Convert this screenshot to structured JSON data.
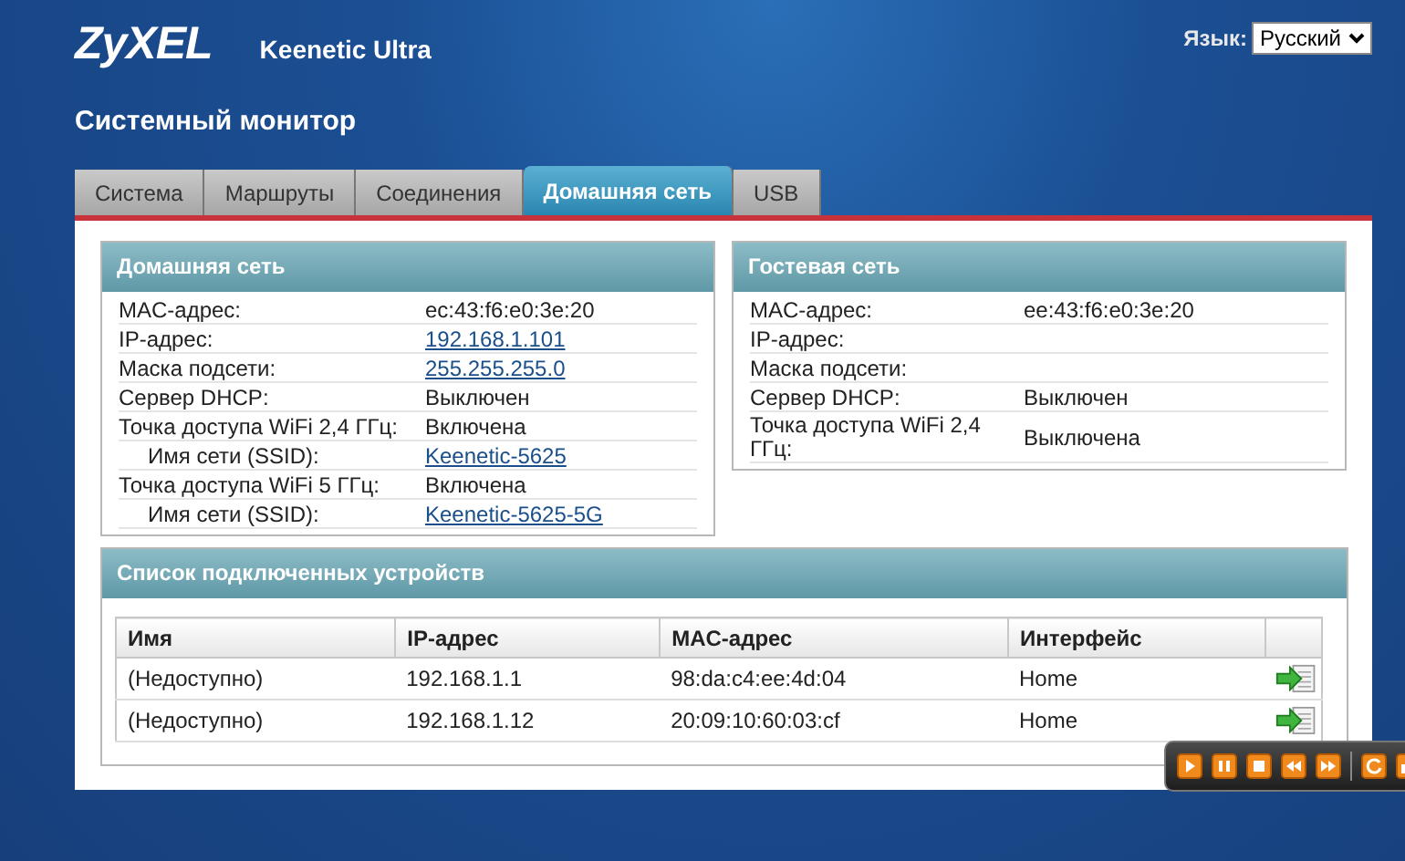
{
  "header": {
    "logo": "ZyXEL",
    "model": "Keenetic Ultra",
    "language_label": "Язык:",
    "language_value": "Русский"
  },
  "page_title": "Системный монитор",
  "tabs": [
    {
      "label": "Система",
      "selected": false
    },
    {
      "label": "Маршруты",
      "selected": false
    },
    {
      "label": "Соединения",
      "selected": false
    },
    {
      "label": "Домашняя сеть",
      "selected": true
    },
    {
      "label": "USB",
      "selected": false
    }
  ],
  "home_network": {
    "title": "Домашняя сеть",
    "rows": [
      {
        "label": "MAC-адрес:",
        "value": "ec:43:f6:e0:3e:20",
        "kind": "text"
      },
      {
        "label": "IP-адрес:",
        "value": "192.168.1.101",
        "kind": "link"
      },
      {
        "label": "Маска подсети:",
        "value": "255.255.255.0",
        "kind": "link"
      },
      {
        "label": "Сервер DHCP:",
        "value": "Выключен",
        "kind": "text"
      },
      {
        "label": "Точка доступа WiFi 2,4 ГГц:",
        "value": "Включена",
        "kind": "text",
        "children": [
          {
            "label": "Имя сети (SSID):",
            "value": "Keenetic-5625",
            "kind": "link"
          }
        ]
      },
      {
        "label": "Точка доступа WiFi 5 ГГц:",
        "value": "Включена",
        "kind": "text",
        "children": [
          {
            "label": "Имя сети (SSID):",
            "value": "Keenetic-5625-5G",
            "kind": "link"
          }
        ]
      }
    ]
  },
  "guest_network": {
    "title": "Гостевая сеть",
    "rows": [
      {
        "label": "MAC-адрес:",
        "value": "ee:43:f6:e0:3e:20",
        "kind": "text"
      },
      {
        "label": "IP-адрес:"
      },
      {
        "label": "Маска подсети:"
      },
      {
        "label": "Сервер DHCP:",
        "value": "Выключен",
        "kind": "text"
      },
      {
        "label": "Точка доступа WiFi 2,4 ГГц:",
        "value": "Выключена",
        "kind": "text"
      }
    ]
  },
  "devices": {
    "title": "Список подключенных устройств",
    "columns": [
      "Имя",
      "IP-адрес",
      "MAC-адрес",
      "Интерфейс"
    ],
    "rows": [
      {
        "cells": [
          "(Недоступно)",
          "192.168.1.1",
          "98:da:c4:ee:4d:04",
          "Home"
        ]
      },
      {
        "cells": [
          "(Недоступно)",
          "192.168.1.12",
          "20:09:10:60:03:cf",
          "Home"
        ]
      }
    ]
  }
}
